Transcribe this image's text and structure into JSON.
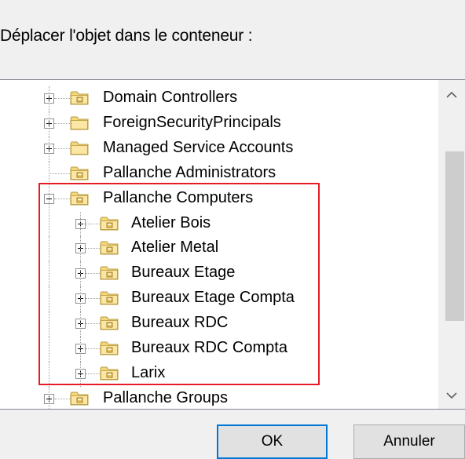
{
  "dialog": {
    "prompt": "Déplacer l'objet dans le conteneur :"
  },
  "tree": {
    "items": [
      {
        "label": "Domain Controllers",
        "level": 1,
        "expander": "plus",
        "icon": "ou-folder-icon"
      },
      {
        "label": "ForeignSecurityPrincipals",
        "level": 1,
        "expander": "plus",
        "icon": "folder-icon"
      },
      {
        "label": "Managed Service Accounts",
        "level": 1,
        "expander": "plus",
        "icon": "folder-icon"
      },
      {
        "label": "Pallanche Administrators",
        "level": 1,
        "expander": "none",
        "icon": "ou-folder-icon"
      },
      {
        "label": "Pallanche Computers",
        "level": 1,
        "expander": "minus",
        "icon": "ou-folder-icon"
      },
      {
        "label": "Atelier Bois",
        "level": 2,
        "expander": "plus",
        "icon": "ou-folder-icon"
      },
      {
        "label": "Atelier Metal",
        "level": 2,
        "expander": "plus",
        "icon": "ou-folder-icon"
      },
      {
        "label": "Bureaux Etage",
        "level": 2,
        "expander": "plus",
        "icon": "ou-folder-icon"
      },
      {
        "label": "Bureaux Etage Compta",
        "level": 2,
        "expander": "plus",
        "icon": "ou-folder-icon"
      },
      {
        "label": "Bureaux RDC",
        "level": 2,
        "expander": "plus",
        "icon": "ou-folder-icon"
      },
      {
        "label": "Bureaux RDC Compta",
        "level": 2,
        "expander": "plus",
        "icon": "ou-folder-icon"
      },
      {
        "label": "Larix",
        "level": 2,
        "expander": "plus",
        "icon": "ou-folder-icon"
      },
      {
        "label": "Pallanche Groups",
        "level": 1,
        "expander": "plus",
        "icon": "ou-folder-icon"
      }
    ],
    "scrollbar": {
      "up_icon": "chevron-up-icon",
      "down_icon": "chevron-down-icon"
    }
  },
  "buttons": {
    "ok_label": "OK",
    "cancel_label": "Annuler"
  },
  "colors": {
    "highlight": "#e51c23",
    "folder_fill": "#f5d77b",
    "folder_outline": "#b89a3e",
    "button_focus": "#0078d7"
  }
}
